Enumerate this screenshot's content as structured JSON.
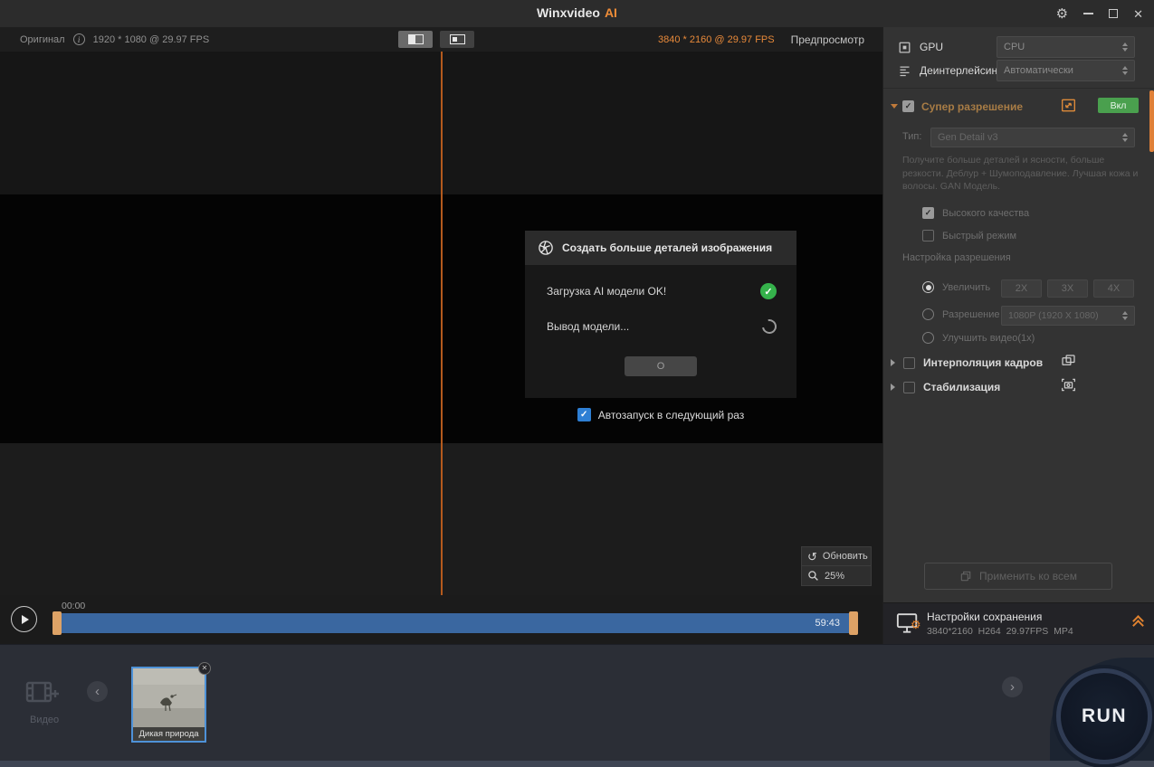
{
  "icons": {
    "gear": "⚙",
    "close": "✕",
    "refresh": "↺",
    "check": "✓",
    "info": "i",
    "nav_left": "‹",
    "nav_right": "›"
  },
  "titlebar": {
    "app_name": "Winxvideo",
    "app_suffix": "AI"
  },
  "preview": {
    "original_label": "Оригинал",
    "original_info": "1920 * 1080 @ 29.97 FPS",
    "output_info": "3840 * 2160 @ 29.97 FPS",
    "preview_label": "Предпросмотр",
    "refresh_label": "Обновить",
    "zoom_level": "25%"
  },
  "modal": {
    "title": "Создать больше деталей изображения",
    "status_loaded": "Загрузка AI модели OK!",
    "status_running": "Вывод модели...",
    "action_label": "O",
    "autorun_label": "Автозапуск в следующий раз"
  },
  "timeline": {
    "current_time": "00:00",
    "duration": "59:43"
  },
  "sidebar": {
    "gpu": {
      "label": "GPU",
      "value": "CPU"
    },
    "deinterlacing": {
      "label": "Деинтерлейсинг",
      "value": "Автоматически"
    },
    "super_resolution": {
      "title": "Супер разрешение",
      "state_badge": "Вкл",
      "type_label": "Тип:",
      "type_value": "Gen Detail v3",
      "description": "Получите больше деталей и ясности, больше резкости. Деблур + Шумоподавление. Лучшая кожа и волосы. GAN Модель.",
      "option_high_quality": "Высокого качества",
      "option_fast_mode": "Быстрый режим",
      "resolution_section": "Настройка разрешения",
      "radio_upscale": "Увеличить",
      "scale_options": [
        "2X",
        "3X",
        "4X"
      ],
      "radio_resolution": "Разрешение",
      "resolution_value": "1080P (1920 X 1080)",
      "radio_enhance": "Улучшить видео(1x)"
    },
    "frame_interpolation": "Интерполяция кадров",
    "stabilization": "Стабилизация",
    "apply_all": "Применить ко всем",
    "save_settings": {
      "title": "Настройки сохранения",
      "format_info": "3840*2160  H264  29.97FPS  MP4"
    }
  },
  "bottom": {
    "video_label": "Видео",
    "clip_title": "Дикая природа",
    "run_label": "RUN"
  }
}
